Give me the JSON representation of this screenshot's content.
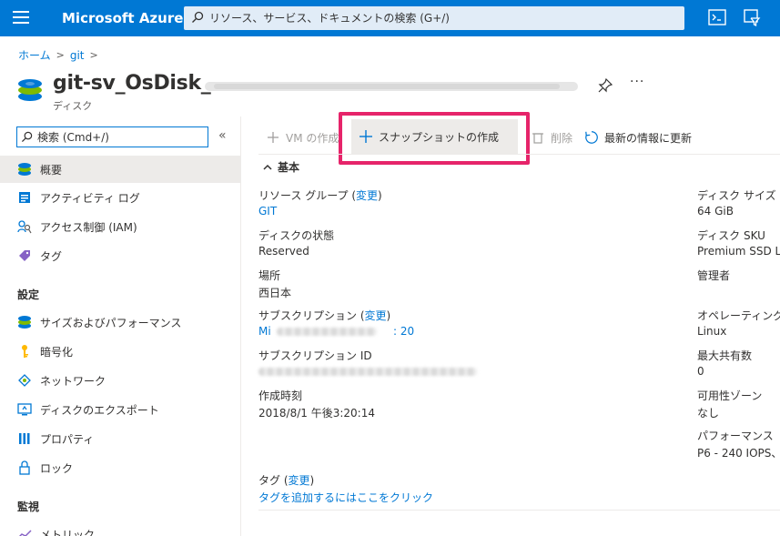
{
  "app": {
    "brand": "Microsoft Azure",
    "search_placeholder": "リソース、サービス、ドキュメントの検索 (G+/)"
  },
  "breadcrumb": {
    "home": "ホーム",
    "git": "git"
  },
  "resource": {
    "title_visible": "git-sv_OsDisk_",
    "type": "ディスク"
  },
  "sidebar": {
    "search_placeholder": "検索 (Cmd+/)",
    "collapse_glyph": "«",
    "items_main": [
      {
        "label": "概要",
        "icon": "overview-disk-icon",
        "active": true
      },
      {
        "label": "アクティビティ ログ",
        "icon": "activity-log-icon"
      },
      {
        "label": "アクセス制御 (IAM)",
        "icon": "access-control-icon"
      },
      {
        "label": "タグ",
        "icon": "tag-icon"
      }
    ],
    "section_settings": "設定",
    "items_settings": [
      {
        "label": "サイズおよびパフォーマンス",
        "icon": "size-performance-icon"
      },
      {
        "label": "暗号化",
        "icon": "encryption-key-icon"
      },
      {
        "label": "ネットワーク",
        "icon": "network-icon"
      },
      {
        "label": "ディスクのエクスポート",
        "icon": "disk-export-icon"
      },
      {
        "label": "プロパティ",
        "icon": "properties-icon"
      },
      {
        "label": "ロック",
        "icon": "lock-icon"
      }
    ],
    "section_monitoring": "監視",
    "items_monitoring": [
      {
        "label": "メトリック",
        "icon": "metrics-icon"
      }
    ]
  },
  "commands": {
    "create_vm": "VM の作成",
    "create_snapshot": "スナップショットの作成",
    "delete": "削除",
    "refresh": "最新の情報に更新"
  },
  "essentials": {
    "header": "基本",
    "left": {
      "resource_group_label": "リソース グループ",
      "change_label": "変更",
      "resource_group_value": "GIT",
      "disk_state_label": "ディスクの状態",
      "disk_state_value": "Reserved",
      "location_label": "場所",
      "location_value": "西日本",
      "subscription_label": "サブスクリプション",
      "subscription_value_prefix": "Mi",
      "subscription_value_suffix": ": 20",
      "subscription_id_label": "サブスクリプション ID",
      "created_label": "作成時刻",
      "created_value": "2018/8/1 午後3:20:14"
    },
    "right": {
      "disk_size_label": "ディスク サイズ",
      "disk_size_value": "64 GiB",
      "disk_sku_label": "ディスク SKU",
      "disk_sku_value": "Premium SSD LR",
      "admin_label": "管理者",
      "os_label": "オペレーティング",
      "os_value": "Linux",
      "max_shares_label": "最大共有数",
      "max_shares_value": "0",
      "availability_zone_label": "可用性ゾーン",
      "availability_zone_value": "なし",
      "performance_label": "パフォーマンス",
      "performance_value": "P6 - 240 IOPS、"
    },
    "tags_label": "タグ",
    "tags_change": "変更",
    "tags_add_link": "タグを追加するにはここをクリック"
  },
  "colors": {
    "azure_blue": "#0078d4",
    "highlight_pink": "#e6246a",
    "active_bg": "#edebe9"
  }
}
